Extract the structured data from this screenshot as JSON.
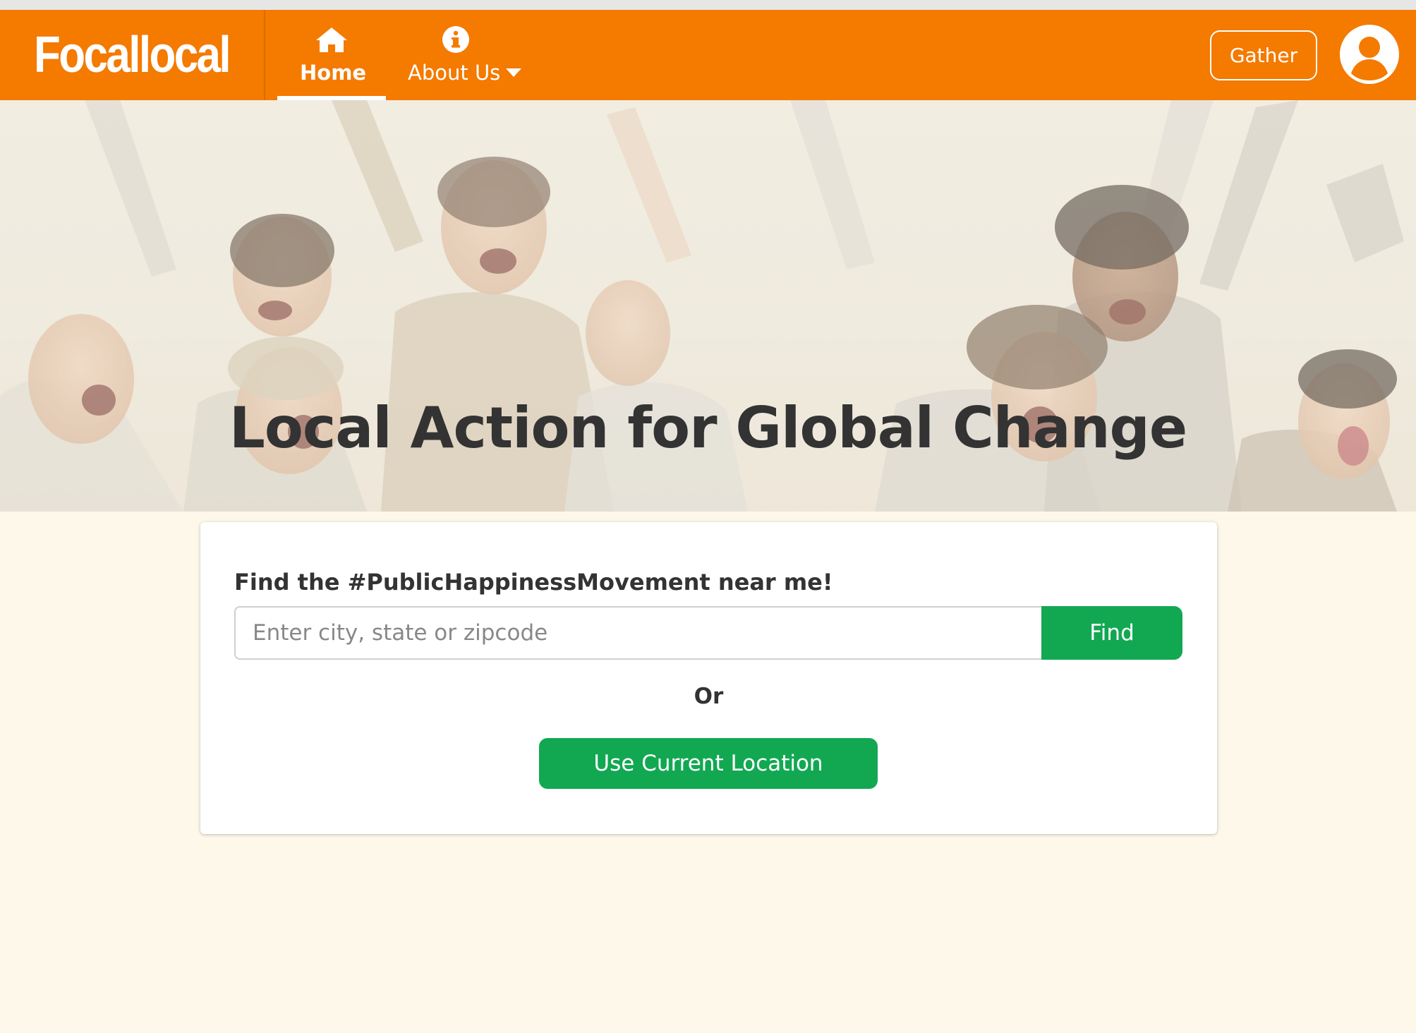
{
  "brand": {
    "name": "Focallocal"
  },
  "nav": {
    "home": {
      "label": "Home",
      "icon": "home-icon"
    },
    "about": {
      "label": "About Us",
      "icon": "info-icon",
      "dropdown_icon": "caret-down-icon"
    }
  },
  "header_right": {
    "gather_label": "Gather",
    "avatar_icon": "user-circle-icon"
  },
  "hero": {
    "title": "Local Action for Global Change",
    "image": "group-of-cheering-people-photo"
  },
  "search": {
    "heading": "Find the #PublicHappinessMovement near me!",
    "placeholder": "Enter city, state or zipcode",
    "value": "",
    "find_label": "Find",
    "or_text": "Or",
    "current_location_label": "Use Current Location"
  },
  "colors": {
    "navbar": "#f47a00",
    "accent_green": "#12a852",
    "page_background": "#fdf8ea",
    "heading_text": "#333333"
  }
}
